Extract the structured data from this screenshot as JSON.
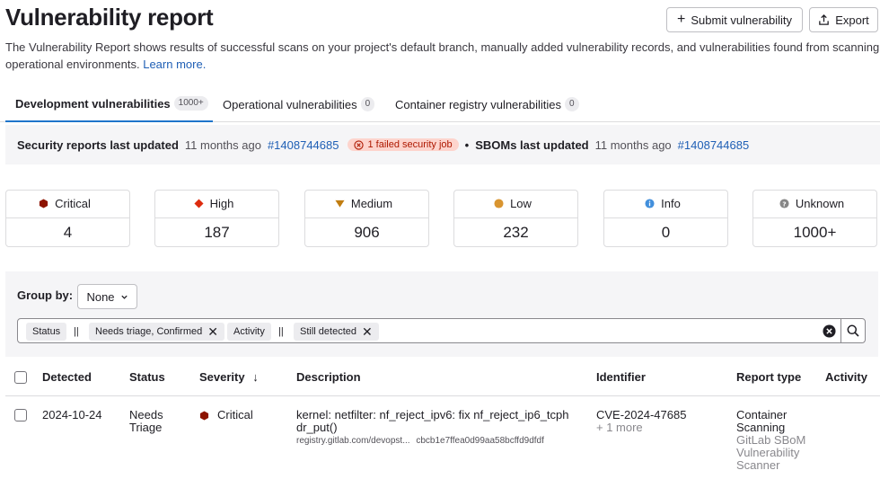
{
  "header": {
    "title": "Vulnerability report",
    "submit_label": "Submit vulnerability",
    "export_label": "Export",
    "intro_text": "The Vulnerability Report shows results of successful scans on your project's default branch, manually added vulnerability records, and vulnerabilities found from scanning operational environments.",
    "learn_more": "Learn more."
  },
  "tabs": [
    {
      "label": "Development vulnerabilities",
      "count": "1000+"
    },
    {
      "label": "Operational vulnerabilities",
      "count": "0"
    },
    {
      "label": "Container registry vulnerabilities",
      "count": "0"
    }
  ],
  "updated": {
    "security_label": "Security reports last updated",
    "security_time": "11 months ago",
    "security_pipeline": "#1408744685",
    "failed_job": "1 failed security job",
    "sboms_label": "SBOMs last updated",
    "sboms_time": "11 months ago",
    "sboms_pipeline": "#1408744685"
  },
  "severity_cards": [
    {
      "label": "Critical",
      "value": "4",
      "color": "#8d1300",
      "icon": "critical-icon"
    },
    {
      "label": "High",
      "value": "187",
      "color": "#dd2b0e",
      "icon": "high-icon"
    },
    {
      "label": "Medium",
      "value": "906",
      "color": "#c17d10",
      "icon": "medium-icon"
    },
    {
      "label": "Low",
      "value": "232",
      "color": "#d99530",
      "icon": "low-icon"
    },
    {
      "label": "Info",
      "value": "0",
      "color": "#428fdc",
      "icon": "info-icon"
    },
    {
      "label": "Unknown",
      "value": "1000+",
      "color": "#868686",
      "icon": "unknown-icon"
    }
  ],
  "filters": {
    "group_by_label": "Group by:",
    "group_by_value": "None",
    "tokens": [
      {
        "key": "Status",
        "op": "||",
        "value": "Needs triage, Confirmed"
      },
      {
        "key": "Activity",
        "op": "||",
        "value": "Still detected"
      }
    ]
  },
  "table": {
    "columns": [
      "Detected",
      "Status",
      "Severity",
      "Description",
      "Identifier",
      "Report type",
      "Activity"
    ],
    "rows": [
      {
        "detected": "2024-10-24",
        "status": "Needs Triage",
        "severity": "Critical",
        "description": "kernel: netfilter: nf_reject_ipv6: fix nf_reject_ip6_tcphdr_put()",
        "location": "registry.gitlab.com/devopst...",
        "hash": "cbcb1e7ffea0d99aa58bcffd9dfdf",
        "identifier": "CVE-2024-47685",
        "identifier_more": "+ 1 more",
        "report_type": "Container Scanning",
        "scanner": "GitLab SBoM Vulnerability Scanner"
      }
    ]
  },
  "colors": {
    "accent": "#1f75cb",
    "link": "#1f5fb5",
    "failed_bg": "#fdd4cd",
    "failed_fg": "#ae1800"
  }
}
